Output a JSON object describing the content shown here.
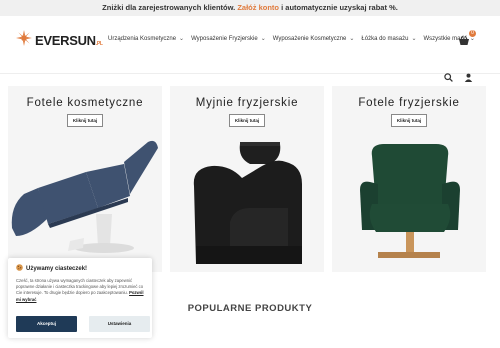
{
  "promo": {
    "text_before": "Zniżki dla zarejestrowanych klientów.",
    "link": "Załóż konto",
    "text_after": "i automatycznie uzyskaj rabat %."
  },
  "brand": {
    "name": "EVERSUN",
    "suffix": ".PL"
  },
  "nav": {
    "items": [
      {
        "label": "Urządzenia Kosmetyczne"
      },
      {
        "label": "Wyposażenie Fryzjerskie"
      },
      {
        "label": "Wyposażenie Kosmetyczne"
      },
      {
        "label": "Łóżka do masażu"
      },
      {
        "label": "Wszystkie marki"
      }
    ]
  },
  "cart": {
    "count": "0"
  },
  "categories": [
    {
      "title": "Fotele kosmetyczne",
      "button": "Kliknij tutaj",
      "icon": "cosmetic-chair"
    },
    {
      "title": "Myjnie fryzjerskie",
      "button": "Kliknij tutaj",
      "icon": "hair-wash-unit"
    },
    {
      "title": "Fotele fryzjerskie",
      "button": "Kliknij tutaj",
      "icon": "barber-chair"
    }
  ],
  "cookie": {
    "title": "Używamy ciasteczek!",
    "text": "Cześć, ta strona używa wymaganych ciasteczek aby zapewnić poprawne działanie i ciasteczka trackingowe aby lepiej zrozumieć co Cie interesuje. To drugie będzie dopiero po zaakceptowaniu.",
    "link": "Pozwól mi wybrać",
    "accept": "Akceptuj",
    "settings": "Ustawienia"
  },
  "section": {
    "popular_title": "POPULARNE PRODUKTY"
  },
  "colors": {
    "accent": "#e07a3c",
    "button_dark": "#1f3a57",
    "chair_blue": "#3f5270",
    "chair_green": "#1f4a35",
    "gold": "#c9955b"
  }
}
